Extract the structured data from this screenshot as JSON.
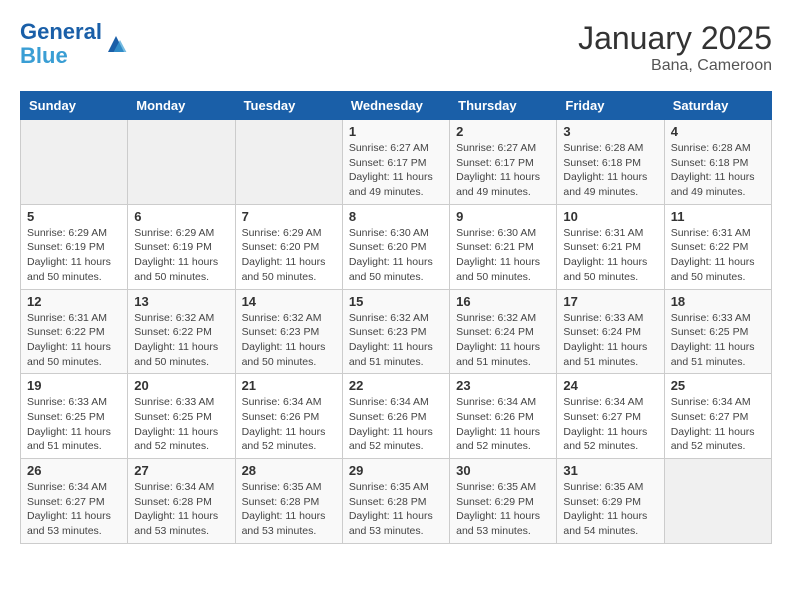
{
  "header": {
    "logo_line1": "General",
    "logo_line2": "Blue",
    "title": "January 2025",
    "subtitle": "Bana, Cameroon"
  },
  "weekdays": [
    "Sunday",
    "Monday",
    "Tuesday",
    "Wednesday",
    "Thursday",
    "Friday",
    "Saturday"
  ],
  "weeks": [
    [
      {
        "day": "",
        "info": ""
      },
      {
        "day": "",
        "info": ""
      },
      {
        "day": "",
        "info": ""
      },
      {
        "day": "1",
        "info": "Sunrise: 6:27 AM\nSunset: 6:17 PM\nDaylight: 11 hours\nand 49 minutes."
      },
      {
        "day": "2",
        "info": "Sunrise: 6:27 AM\nSunset: 6:17 PM\nDaylight: 11 hours\nand 49 minutes."
      },
      {
        "day": "3",
        "info": "Sunrise: 6:28 AM\nSunset: 6:18 PM\nDaylight: 11 hours\nand 49 minutes."
      },
      {
        "day": "4",
        "info": "Sunrise: 6:28 AM\nSunset: 6:18 PM\nDaylight: 11 hours\nand 49 minutes."
      }
    ],
    [
      {
        "day": "5",
        "info": "Sunrise: 6:29 AM\nSunset: 6:19 PM\nDaylight: 11 hours\nand 50 minutes."
      },
      {
        "day": "6",
        "info": "Sunrise: 6:29 AM\nSunset: 6:19 PM\nDaylight: 11 hours\nand 50 minutes."
      },
      {
        "day": "7",
        "info": "Sunrise: 6:29 AM\nSunset: 6:20 PM\nDaylight: 11 hours\nand 50 minutes."
      },
      {
        "day": "8",
        "info": "Sunrise: 6:30 AM\nSunset: 6:20 PM\nDaylight: 11 hours\nand 50 minutes."
      },
      {
        "day": "9",
        "info": "Sunrise: 6:30 AM\nSunset: 6:21 PM\nDaylight: 11 hours\nand 50 minutes."
      },
      {
        "day": "10",
        "info": "Sunrise: 6:31 AM\nSunset: 6:21 PM\nDaylight: 11 hours\nand 50 minutes."
      },
      {
        "day": "11",
        "info": "Sunrise: 6:31 AM\nSunset: 6:22 PM\nDaylight: 11 hours\nand 50 minutes."
      }
    ],
    [
      {
        "day": "12",
        "info": "Sunrise: 6:31 AM\nSunset: 6:22 PM\nDaylight: 11 hours\nand 50 minutes."
      },
      {
        "day": "13",
        "info": "Sunrise: 6:32 AM\nSunset: 6:22 PM\nDaylight: 11 hours\nand 50 minutes."
      },
      {
        "day": "14",
        "info": "Sunrise: 6:32 AM\nSunset: 6:23 PM\nDaylight: 11 hours\nand 50 minutes."
      },
      {
        "day": "15",
        "info": "Sunrise: 6:32 AM\nSunset: 6:23 PM\nDaylight: 11 hours\nand 51 minutes."
      },
      {
        "day": "16",
        "info": "Sunrise: 6:32 AM\nSunset: 6:24 PM\nDaylight: 11 hours\nand 51 minutes."
      },
      {
        "day": "17",
        "info": "Sunrise: 6:33 AM\nSunset: 6:24 PM\nDaylight: 11 hours\nand 51 minutes."
      },
      {
        "day": "18",
        "info": "Sunrise: 6:33 AM\nSunset: 6:25 PM\nDaylight: 11 hours\nand 51 minutes."
      }
    ],
    [
      {
        "day": "19",
        "info": "Sunrise: 6:33 AM\nSunset: 6:25 PM\nDaylight: 11 hours\nand 51 minutes."
      },
      {
        "day": "20",
        "info": "Sunrise: 6:33 AM\nSunset: 6:25 PM\nDaylight: 11 hours\nand 52 minutes."
      },
      {
        "day": "21",
        "info": "Sunrise: 6:34 AM\nSunset: 6:26 PM\nDaylight: 11 hours\nand 52 minutes."
      },
      {
        "day": "22",
        "info": "Sunrise: 6:34 AM\nSunset: 6:26 PM\nDaylight: 11 hours\nand 52 minutes."
      },
      {
        "day": "23",
        "info": "Sunrise: 6:34 AM\nSunset: 6:26 PM\nDaylight: 11 hours\nand 52 minutes."
      },
      {
        "day": "24",
        "info": "Sunrise: 6:34 AM\nSunset: 6:27 PM\nDaylight: 11 hours\nand 52 minutes."
      },
      {
        "day": "25",
        "info": "Sunrise: 6:34 AM\nSunset: 6:27 PM\nDaylight: 11 hours\nand 52 minutes."
      }
    ],
    [
      {
        "day": "26",
        "info": "Sunrise: 6:34 AM\nSunset: 6:27 PM\nDaylight: 11 hours\nand 53 minutes."
      },
      {
        "day": "27",
        "info": "Sunrise: 6:34 AM\nSunset: 6:28 PM\nDaylight: 11 hours\nand 53 minutes."
      },
      {
        "day": "28",
        "info": "Sunrise: 6:35 AM\nSunset: 6:28 PM\nDaylight: 11 hours\nand 53 minutes."
      },
      {
        "day": "29",
        "info": "Sunrise: 6:35 AM\nSunset: 6:28 PM\nDaylight: 11 hours\nand 53 minutes."
      },
      {
        "day": "30",
        "info": "Sunrise: 6:35 AM\nSunset: 6:29 PM\nDaylight: 11 hours\nand 53 minutes."
      },
      {
        "day": "31",
        "info": "Sunrise: 6:35 AM\nSunset: 6:29 PM\nDaylight: 11 hours\nand 54 minutes."
      },
      {
        "day": "",
        "info": ""
      }
    ]
  ]
}
